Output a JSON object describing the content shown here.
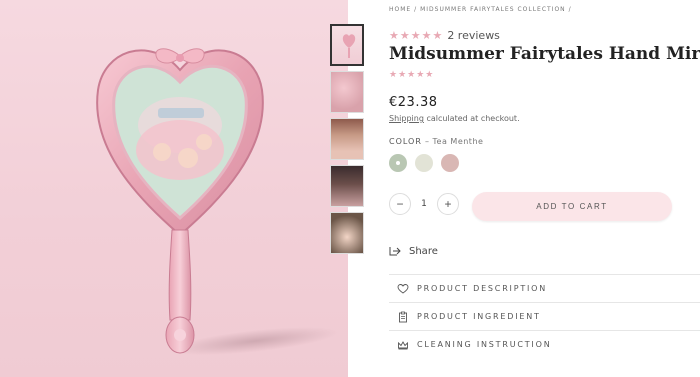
{
  "breadcrumb": {
    "home": "HOME",
    "sep1": "/",
    "collection": "MIDSUMMER FAIRYTALES COLLECTION",
    "sep2": "/"
  },
  "product": {
    "rating_stars": "★★★★★",
    "reviews_label": "2 reviews",
    "title": "Midsummer Fairytales Hand Mirror",
    "stars_secondary": "★★★★★",
    "price": "€23.38",
    "shipping_link": "Shipping",
    "shipping_rest": " calculated at checkout.",
    "color_label": "COLOR",
    "color_sep": " – ",
    "color_value": "Tea Menthe"
  },
  "swatches": [
    {
      "name": "Tea Menthe",
      "color": "#b9c7b3",
      "selected": true
    },
    {
      "name": "Cream",
      "color": "#e2e3d6",
      "selected": false
    },
    {
      "name": "Rose",
      "color": "#d9b7b4",
      "selected": false
    }
  ],
  "quantity": {
    "minus": "−",
    "value": "1",
    "plus": "+"
  },
  "cart": {
    "label": "ADD TO CART"
  },
  "share": {
    "label": "Share"
  },
  "accordion": [
    {
      "label": "PRODUCT DESCRIPTION",
      "icon": "heart-icon"
    },
    {
      "label": "PRODUCT INGREDIENT",
      "icon": "clipboard-icon"
    },
    {
      "label": "CLEANING INSTRUCTION",
      "icon": "crown-icon"
    }
  ],
  "colors": {
    "accent_pink": "#e8a9b4",
    "cart_bg": "#fbe5e8",
    "hero_bg": "#f4d4dc"
  }
}
